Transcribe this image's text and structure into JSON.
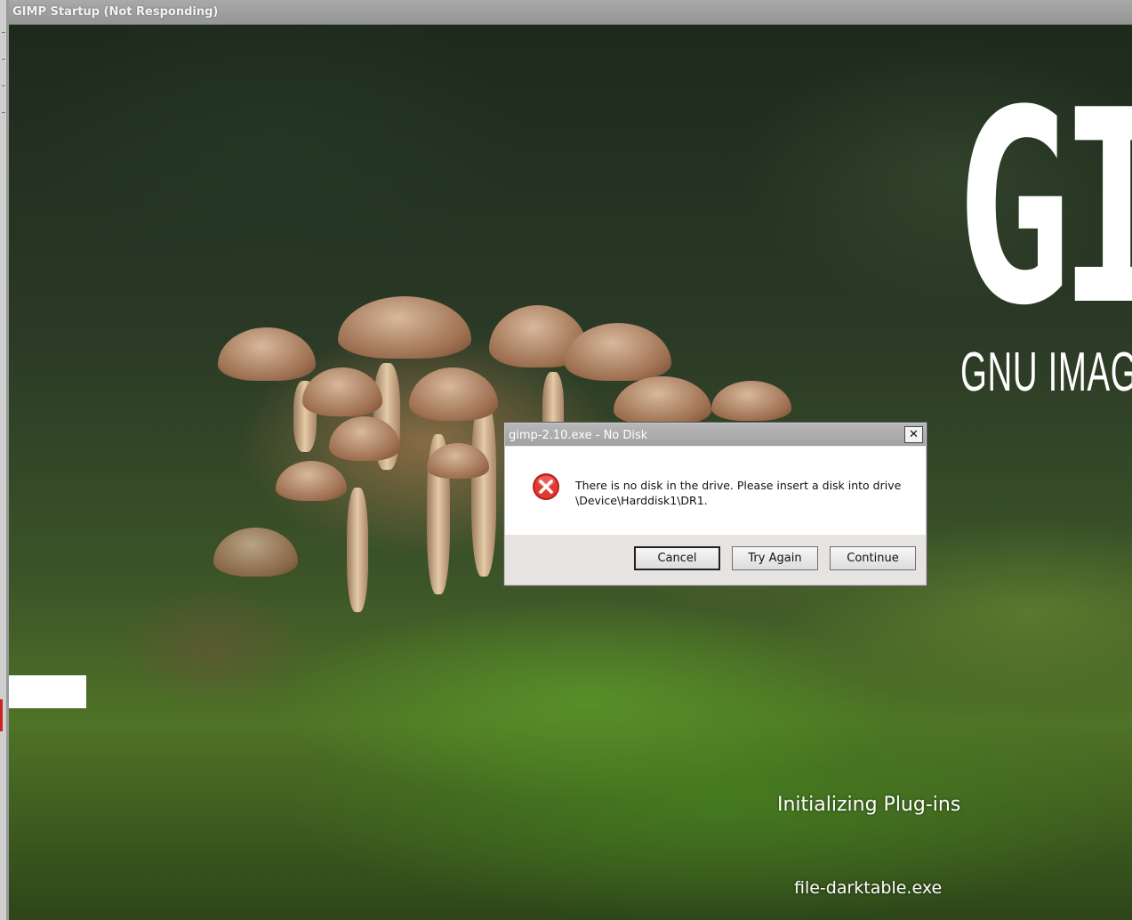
{
  "splash": {
    "window_title": "GIMP Startup (Not Responding)",
    "brand_title": "GIMP",
    "brand_subtitle": "GNU IMAGE MANIPULATION PROGRAM",
    "status_message": "Initializing Plug-ins",
    "status_file": "file-darktable.exe"
  },
  "dialog": {
    "title": "gimp-2.10.exe - No Disk",
    "close_symbol": "✕",
    "icon": "error-icon",
    "message_line1": "There is no disk in the drive. Please insert a disk into drive",
    "message_line2": "\\Device\\Harddisk1\\DR1.",
    "buttons": {
      "cancel": "Cancel",
      "try_again": "Try Again",
      "continue": "Continue"
    }
  },
  "colors": {
    "error_red": "#d9302c",
    "dialog_body": "#ffffff",
    "dialog_footer": "#e6e3e0"
  }
}
